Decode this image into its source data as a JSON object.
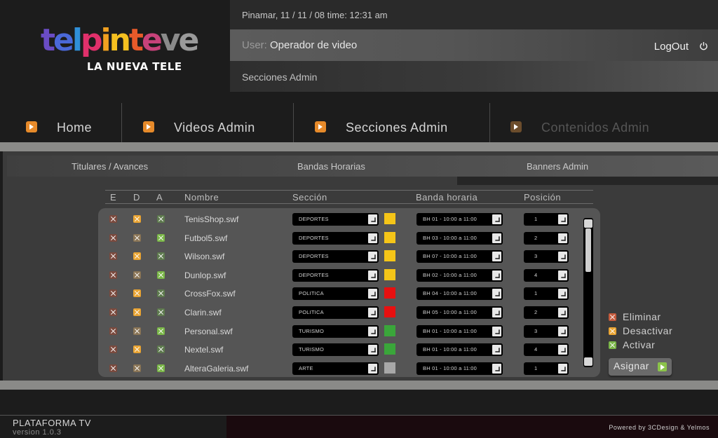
{
  "header": {
    "logo": {
      "letters": [
        {
          "ch": "t",
          "color": "#6a4cc4"
        },
        {
          "ch": "e",
          "color": "#4a68d8"
        },
        {
          "ch": "l",
          "color": "#2f8fd8"
        },
        {
          "ch": "p",
          "color": "#e0306b"
        },
        {
          "ch": "i",
          "color": "#f0a020"
        },
        {
          "ch": "n",
          "color": "#f5c020"
        },
        {
          "ch": "t",
          "color": "#e85a2a"
        },
        {
          "ch": "e",
          "color": "#c7427a"
        },
        {
          "ch": "v",
          "color": "#8a8a8a"
        },
        {
          "ch": "e",
          "color": "#9a9a9a"
        }
      ],
      "tagline": "LA NUEVA TELE"
    },
    "datetime": "Pinamar, 11 / 11 / 08   time: 12:31 am",
    "user_label": "User:",
    "user_name": "Operador de video",
    "logout": "LogOut",
    "section_title": "Secciones Admin"
  },
  "nav": [
    {
      "label": "Home",
      "active": true
    },
    {
      "label": "Videos Admin",
      "active": true
    },
    {
      "label": "Secciones Admin",
      "active": true
    },
    {
      "label": "Contenidos Admin",
      "active": false
    }
  ],
  "subtabs": [
    "Titulares / Avances",
    "Bandas Horarias",
    "Banners Admin"
  ],
  "table": {
    "headers": {
      "e": "E",
      "d": "D",
      "a": "A",
      "nombre": "Nombre",
      "seccion": "Sección",
      "banda": "Banda horaria",
      "posicion": "Posición"
    },
    "rows": [
      {
        "nombre": "TenisShop.swf",
        "seccion": "DEPORTES",
        "color": "#f5c518",
        "banda": "BH 01 - 10:00 a 11:00",
        "posicion": "1",
        "d_on": true,
        "a_on": false
      },
      {
        "nombre": "Futbol5.swf",
        "seccion": "DEPORTES",
        "color": "#f5c518",
        "banda": "BH 03 - 10:00 a 11:00",
        "posicion": "2",
        "d_on": false,
        "a_on": true
      },
      {
        "nombre": "Wilson.swf",
        "seccion": "DEPORTES",
        "color": "#f5c518",
        "banda": "BH 07 - 10:00 a 11:00",
        "posicion": "3",
        "d_on": true,
        "a_on": false
      },
      {
        "nombre": "Dunlop.swf",
        "seccion": "DEPORTES",
        "color": "#f5c518",
        "banda": "BH 02 - 10:00 a 11:00",
        "posicion": "4",
        "d_on": false,
        "a_on": true
      },
      {
        "nombre": "CrossFox.swf",
        "seccion": "POLITICA",
        "color": "#e81010",
        "banda": "BH 04 - 10:00 a 11:00",
        "posicion": "1",
        "d_on": true,
        "a_on": false
      },
      {
        "nombre": "Clarin.swf",
        "seccion": "POLITICA",
        "color": "#e81010",
        "banda": "BH 05 - 10:00 a 11:00",
        "posicion": "2",
        "d_on": true,
        "a_on": false
      },
      {
        "nombre": "Personal.swf",
        "seccion": "TURISMO",
        "color": "#3aa63a",
        "banda": "BH 01 - 10:00 a 11:00",
        "posicion": "3",
        "d_on": false,
        "a_on": true
      },
      {
        "nombre": "Nextel.swf",
        "seccion": "TURISMO",
        "color": "#3aa63a",
        "banda": "BH 01 - 10:00 a 11:00",
        "posicion": "4",
        "d_on": true,
        "a_on": false
      },
      {
        "nombre": "AlteraGaleria.swf",
        "seccion": "ARTE",
        "color": "#a8a8a8",
        "banda": "BH 01 - 10:00 a 11:00",
        "posicion": "1",
        "d_on": false,
        "a_on": true
      }
    ]
  },
  "legend": {
    "eliminar": "Eliminar",
    "desactivar": "Desactivar",
    "activar": "Activar",
    "asignar": "Asignar"
  },
  "footer": {
    "platform": "PLATAFORMA TV",
    "version": "version 1.0.3",
    "powered": "Powered by 3CDesign & Yelmos"
  }
}
